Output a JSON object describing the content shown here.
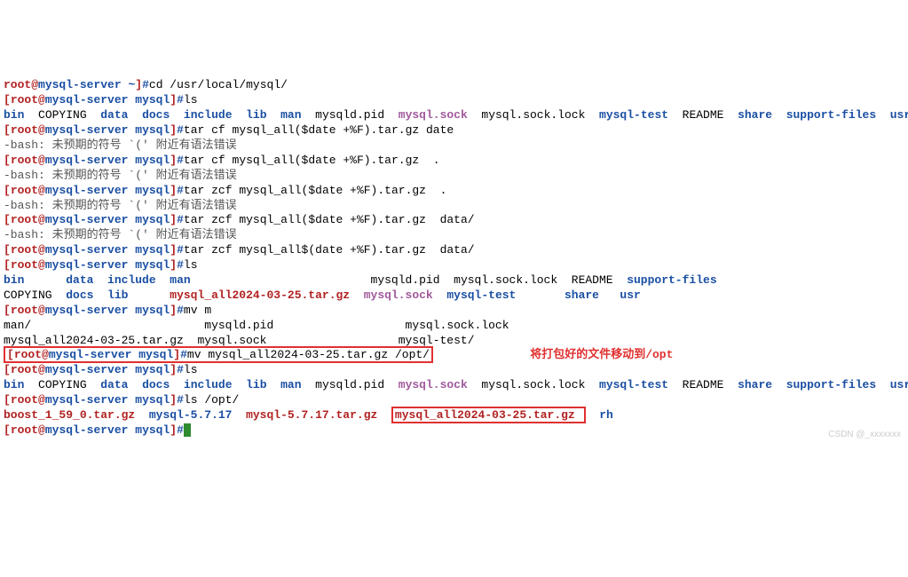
{
  "prompt": {
    "user": "root",
    "at": "@",
    "host": "mysql-server",
    "path_home": "~",
    "path_mysql": "mysql",
    "hash": "#"
  },
  "cmds": {
    "cd": "cd /usr/local/mysql/",
    "ls": "ls",
    "tar1": "tar cf mysql_all($date +%F).tar.gz date",
    "tar2": "tar cf mysql_all($date +%F).tar.gz  .",
    "tar3": "tar zcf mysql_all($date +%F).tar.gz  .",
    "tar4": "tar zcf mysql_all($date +%F).tar.gz  data/",
    "tar5": "tar zcf mysql_all$(date +%F).tar.gz  data/",
    "mvm": "mv m",
    "mv": "mv mysql_all2024-03-25.tar.gz /opt/",
    "lsopt": "ls /opt/"
  },
  "err": {
    "bash": "-bash: 未预期的符号 `(' 附近有语法错误"
  },
  "ls1": {
    "bin": "bin",
    "copying": "COPYING",
    "data": "data",
    "docs": "docs",
    "include": "include",
    "lib": "lib",
    "man": "man",
    "pid": "mysqld.pid",
    "sock": "mysql.sock",
    "socklock": "mysql.sock.lock",
    "mysqltest": "mysql-test",
    "readme": "README",
    "share": "share",
    "support": "support-files",
    "usr": "usr"
  },
  "ls2a": {
    "bin": "bin",
    "data": "data",
    "include": "include",
    "man": "man",
    "pid": "mysqld.pid",
    "socklock": "mysql.sock.lock",
    "readme": "README",
    "support": "support-files"
  },
  "ls2b": {
    "copying": "COPYING",
    "docs": "docs",
    "lib": "lib",
    "tgz": "mysql_all2024-03-25.tar.gz",
    "sock": "mysql.sock",
    "mysqltest": "mysql-test",
    "share": "share",
    "usr": "usr"
  },
  "mvtab": {
    "man": "man/",
    "pid": "mysqld.pid",
    "socklock": "mysql.sock.lock",
    "tgz": "mysql_all2024-03-25.tar.gz",
    "sock": "mysql.sock",
    "mysqltest": "mysql-test/"
  },
  "lsopt": {
    "boost": "boost_1_59_0.tar.gz",
    "mysql5717dir": "mysql-5.7.17",
    "mysql5717tar": "mysql-5.7.17.tar.gz",
    "mysqlall": "mysql_all2024-03-25.tar.gz",
    "rh": "rh"
  },
  "annotation": "将打包好的文件移动到/opt",
  "watermark": "CSDN @_xxxxxxx"
}
